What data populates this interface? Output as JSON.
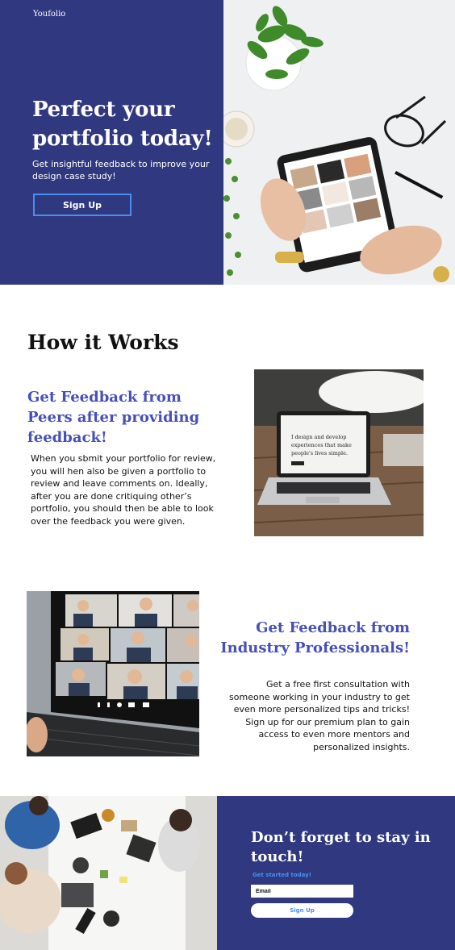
{
  "brand": {
    "logo": "Youfolio",
    "colors": {
      "primary": "#303880",
      "accent_text": "#4650b8",
      "button_outline": "#4a8ff0"
    }
  },
  "hero": {
    "title": "Perfect your portfolio today!",
    "subtitle": "Get insightful feedback to improve your design case study!",
    "signup_label": "Sign Up",
    "image_icon": "tablet-portfolio-photo"
  },
  "how_it_works": {
    "title": "How it Works",
    "features": [
      {
        "title": "Get Feedback from Peers after providing feedback!",
        "body": "When you sbmit your portfolio for review, you will hen also be given a portfolio to review and leave comments on. Ideally, after you are done critiquing other’s portfolio, you should then be able to look over the feedback you were given.",
        "image_icon": "laptop-photo",
        "laptop_text": "I design and develop experiences that make people's lives simple."
      },
      {
        "title": "Get Feedback from Industry Professionals!",
        "body": "Get a free first consultation with someone working in your industry to get even more personalized tips and tricks! Sign up for our premium plan to gain access to even more mentors and personalized insights.",
        "image_icon": "video-call-photo"
      }
    ]
  },
  "cta": {
    "title": "Don’t forget to stay in touch!",
    "small_label": "Get started today!",
    "email_placeholder": "Email",
    "signup_label": "Sign Up",
    "image_icon": "team-meeting-photo"
  }
}
